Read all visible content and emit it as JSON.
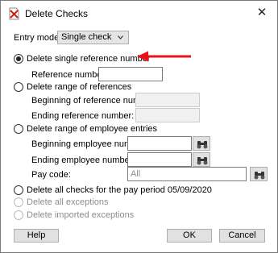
{
  "window": {
    "title": "Delete Checks",
    "close_glyph": "✕"
  },
  "entry_mode": {
    "label": "Entry mode:",
    "selected": "Single check"
  },
  "options": {
    "single_reference": {
      "label": "Delete single reference number",
      "selected": true,
      "reference_label": "Reference number:",
      "reference_value": ""
    },
    "range_references": {
      "label": "Delete range of references",
      "beginning_label": "Beginning of reference number:",
      "ending_label": "Ending reference number:"
    },
    "range_employees": {
      "label": "Delete range of employee entries",
      "beginning_label": "Beginning employee number:",
      "ending_label": "Ending employee number:",
      "pay_code_label": "Pay code:",
      "pay_code_value": "All"
    },
    "all_checks": {
      "label": "Delete all checks for the pay period 05/09/2020"
    },
    "all_exceptions": {
      "label": "Delete all exceptions"
    },
    "imported_exceptions": {
      "label": "Delete imported exceptions"
    }
  },
  "buttons": {
    "help": "Help",
    "ok": "OK",
    "cancel": "Cancel"
  },
  "colors": {
    "annotation_arrow": "#e8141b"
  },
  "icons": {
    "title": "delete-checks-icon",
    "lookup": "binoculars-icon",
    "dropdown": "chevron-down-icon"
  }
}
